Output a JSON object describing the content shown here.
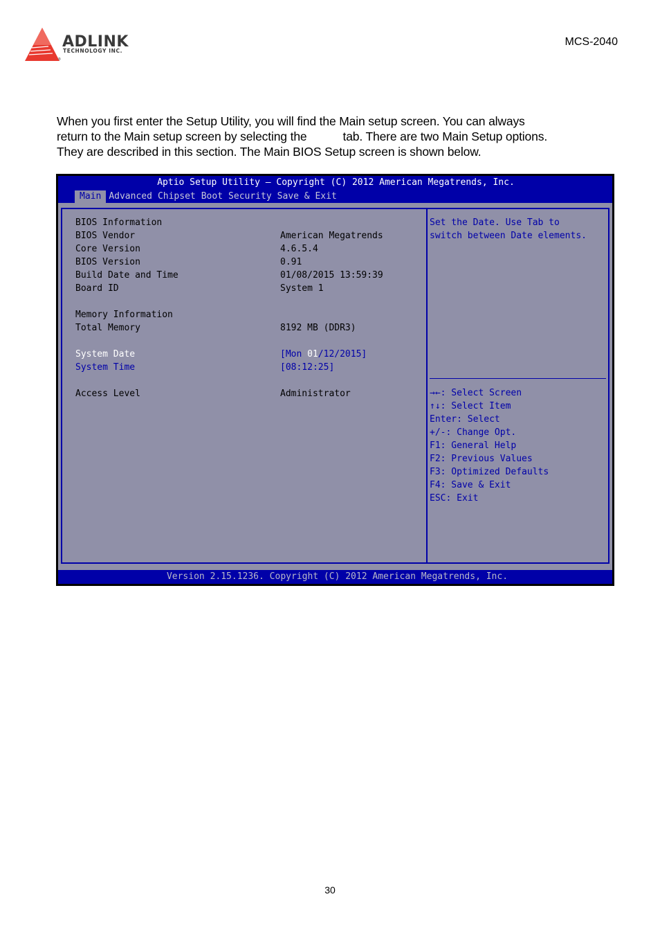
{
  "header": {
    "logo": {
      "brand": "ADLINK",
      "tagline": "TECHNOLOGY INC.",
      "registered_mark": "®",
      "icon": "adlink-triangle-logo-icon",
      "color": "#e8392f"
    },
    "model": "MCS-2040"
  },
  "intro": {
    "line1": "When you first enter the Setup Utility, you will find the Main setup screen. You can always",
    "line2a": "return to the Main setup screen by selecting the",
    "line2b": "tab. There are two Main Setup options.",
    "line3": "They are described in this section. The Main BIOS Setup screen is shown below."
  },
  "bios": {
    "colors": {
      "header_bg": "#0000a8",
      "panel_bg": "#9090a8",
      "highlight_text": "#ffffff",
      "accent_text": "#0000a8"
    },
    "title": "Aptio Setup Utility – Copyright (C) 2012 American Megatrends, Inc.",
    "tabs": [
      {
        "label": "Main",
        "active": true
      },
      {
        "label": "Advanced",
        "active": false
      },
      {
        "label": "Chipset",
        "active": false
      },
      {
        "label": "Boot",
        "active": false
      },
      {
        "label": "Security",
        "active": false
      },
      {
        "label": "Save & Exit",
        "active": false
      }
    ],
    "rows": {
      "bios_information": {
        "label": "BIOS Information"
      },
      "bios_vendor": {
        "label": "BIOS Vendor",
        "value": "American Megatrends"
      },
      "core_version": {
        "label": "Core Version",
        "value": "4.6.5.4"
      },
      "bios_version": {
        "label": "BIOS Version",
        "value": "0.91"
      },
      "build_date": {
        "label": "Build Date and Time",
        "value": "01/08/2015 13:59:39"
      },
      "board_id": {
        "label": "Board ID",
        "value": "System 1"
      },
      "memory_information": {
        "label": "Memory Information"
      },
      "total_memory": {
        "label": "Total Memory",
        "value": "8192 MB (DDR3)"
      },
      "system_date": {
        "label": "System Date",
        "value_prefix": "[Mon ",
        "value_highlight": "01",
        "value_suffix": "/12/2015]"
      },
      "system_time": {
        "label": "System Time",
        "value": "[08:12:25]"
      },
      "access_level": {
        "label": "Access Level",
        "value": "Administrator"
      }
    },
    "help_text": [
      "Set the Date. Use Tab to",
      "switch between Date elements."
    ],
    "key_help": [
      "→←: Select Screen",
      "↑↓: Select Item",
      "Enter: Select",
      "+/-: Change Opt.",
      "F1: General Help",
      "F2: Previous Values",
      "F3: Optimized Defaults",
      "F4: Save & Exit",
      "ESC: Exit"
    ],
    "footer": "Version 2.15.1236. Copyright (C) 2012 American Megatrends, Inc."
  },
  "page_number": "30"
}
